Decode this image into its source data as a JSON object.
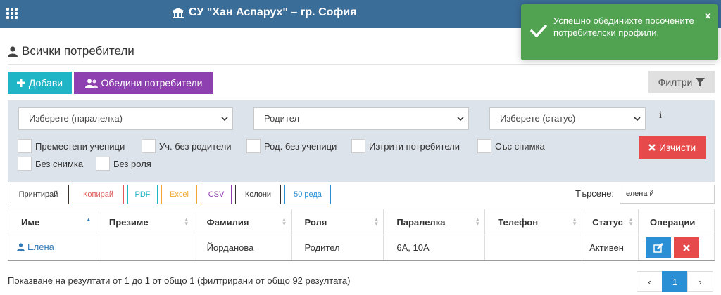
{
  "header": {
    "school_name": "СУ \"Хан Аспарух\" – гр. София"
  },
  "toast": {
    "message": "Успешно обединихте посочените потребителски профили.",
    "close": "×",
    "color": "#51a351"
  },
  "page": {
    "title": "Всички потребители"
  },
  "actions": {
    "add_label": "Добави",
    "merge_label": "Обедини потребители",
    "filters_label": "Филтри"
  },
  "filters": {
    "class_select": "Изберете (паралелка)",
    "role_select": "Родител",
    "status_select": "Изберете (статус)",
    "info": "i",
    "checkboxes": [
      "Преместени ученици",
      "Уч. без родители",
      "Род. без ученици",
      "Изтрити потребители",
      "Със снимка",
      "Без снимка",
      "Без роля"
    ],
    "clear_label": "Изчисти"
  },
  "table_buttons": [
    {
      "label": "Принтирай",
      "color": "#333333"
    },
    {
      "label": "Копирай",
      "color": "#e05a5a"
    },
    {
      "label": "PDF",
      "color": "#1fb5c6"
    },
    {
      "label": "Excel",
      "color": "#f0a830"
    },
    {
      "label": "CSV",
      "color": "#8e3fb0"
    },
    {
      "label": "Колони",
      "color": "#333333"
    },
    {
      "label": "50 реда",
      "color": "#2a8fd4"
    }
  ],
  "search": {
    "label": "Търсене:",
    "value": "елена й"
  },
  "table": {
    "columns": [
      "Име",
      "Презиме",
      "Фамилия",
      "Роля",
      "Паралелка",
      "Телефон",
      "Статус",
      "Операции"
    ],
    "rows": [
      {
        "first_name": "Елена",
        "middle_name": "",
        "last_name": "Йорданова",
        "role": "Родител",
        "classes": "6А, 10А",
        "phone": "",
        "status": "Активен"
      }
    ]
  },
  "footer": {
    "info": "Показване на резултати от 1 до 1 от общо 1 (филтрирани от общо 92 резултата)"
  },
  "pagination": {
    "prev": "‹",
    "current": "1",
    "next": "›"
  },
  "colors": {
    "topbar": "#3b6d99",
    "add": "#1fb5c6",
    "merge": "#8e3fb0",
    "danger": "#e64a4a",
    "primary": "#2a8fd4"
  }
}
